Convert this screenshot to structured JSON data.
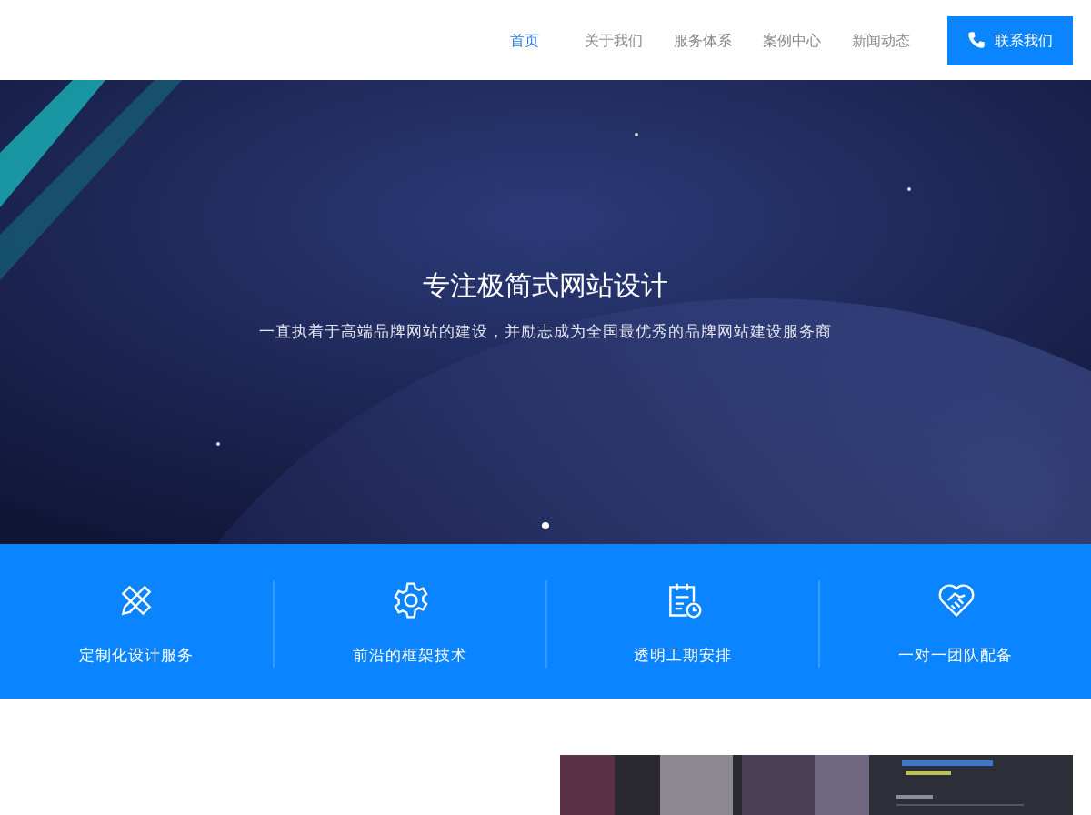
{
  "nav": {
    "items": [
      {
        "label": "首页",
        "selected": true
      },
      {
        "label": "关于我们",
        "selected": false
      },
      {
        "label": "服务体系",
        "selected": false
      },
      {
        "label": "案例中心",
        "selected": false
      },
      {
        "label": "新闻动态",
        "selected": false
      }
    ],
    "contact_button": "联系我们"
  },
  "hero": {
    "title": "专注极简式网站设计",
    "subtitle": "一直执着于高端品牌网站的建设，并励志成为全国最优秀的品牌网站建设服务商",
    "dots": [
      {
        "selected": true
      }
    ]
  },
  "features": [
    {
      "label": "定制化设计服务"
    },
    {
      "label": "前沿的框架技术"
    },
    {
      "label": "透明工期安排"
    },
    {
      "label": "一对一团队配备"
    }
  ]
}
